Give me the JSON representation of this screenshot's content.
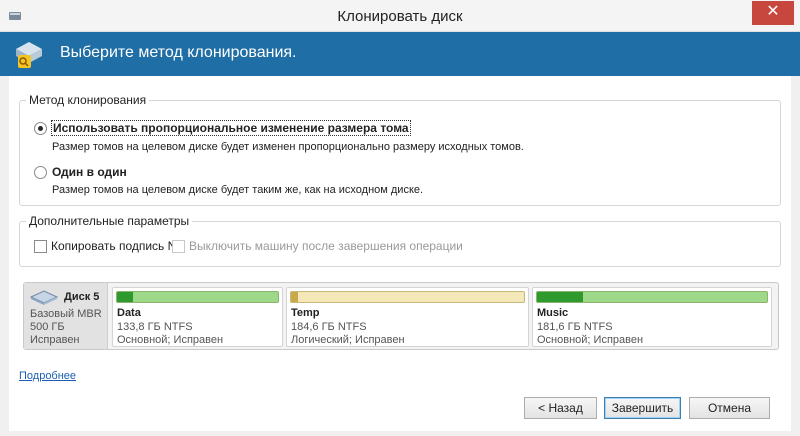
{
  "window": {
    "title": "Клонировать диск",
    "close_glyph": "✕",
    "app_icon": "app-icon"
  },
  "banner": {
    "text": "Выберите метод клонирования.",
    "icon": "clone-disk-icon"
  },
  "method_group": {
    "legend": "Метод клонирования",
    "options": [
      {
        "label": "Использовать пропорциональное изменение размера тома",
        "description": "Размер томов на целевом диске будет изменен пропорционально размеру исходных томов.",
        "checked": true
      },
      {
        "label": "Один в один",
        "description": "Размер томов на целевом диске будет таким же, как на исходном диске.",
        "checked": false
      }
    ]
  },
  "extra_group": {
    "legend": "Дополнительные параметры",
    "copy_nt_signature": {
      "label": "Копировать подпись NT",
      "checked": false
    },
    "shutdown_after": {
      "label": "Выключить машину после завершения операции",
      "checked": false,
      "disabled": true
    }
  },
  "disk": {
    "name": "Диск 5",
    "type": "Базовый MBR",
    "size": "500 ГБ",
    "status": "Исправен",
    "partitions": [
      {
        "name": "Data",
        "size": "133,8 ГБ NTFS",
        "status": "Основной; Исправен",
        "used_fraction": 0.1,
        "color": "green"
      },
      {
        "name": "Temp",
        "size": "184,6 ГБ NTFS",
        "status": "Логический; Исправен",
        "used_fraction": 0.03,
        "color": "yellow"
      },
      {
        "name": "Music",
        "size": "181,6 ГБ NTFS",
        "status": "Основной; Исправен",
        "used_fraction": 0.2,
        "color": "green"
      }
    ]
  },
  "details_link": "Подробнее",
  "buttons": {
    "back": "< Назад",
    "finish": "Завершить",
    "cancel": "Отмена"
  },
  "colors": {
    "banner": "#1f6ea5",
    "close": "#c7463d",
    "link": "#1a5fb4"
  }
}
